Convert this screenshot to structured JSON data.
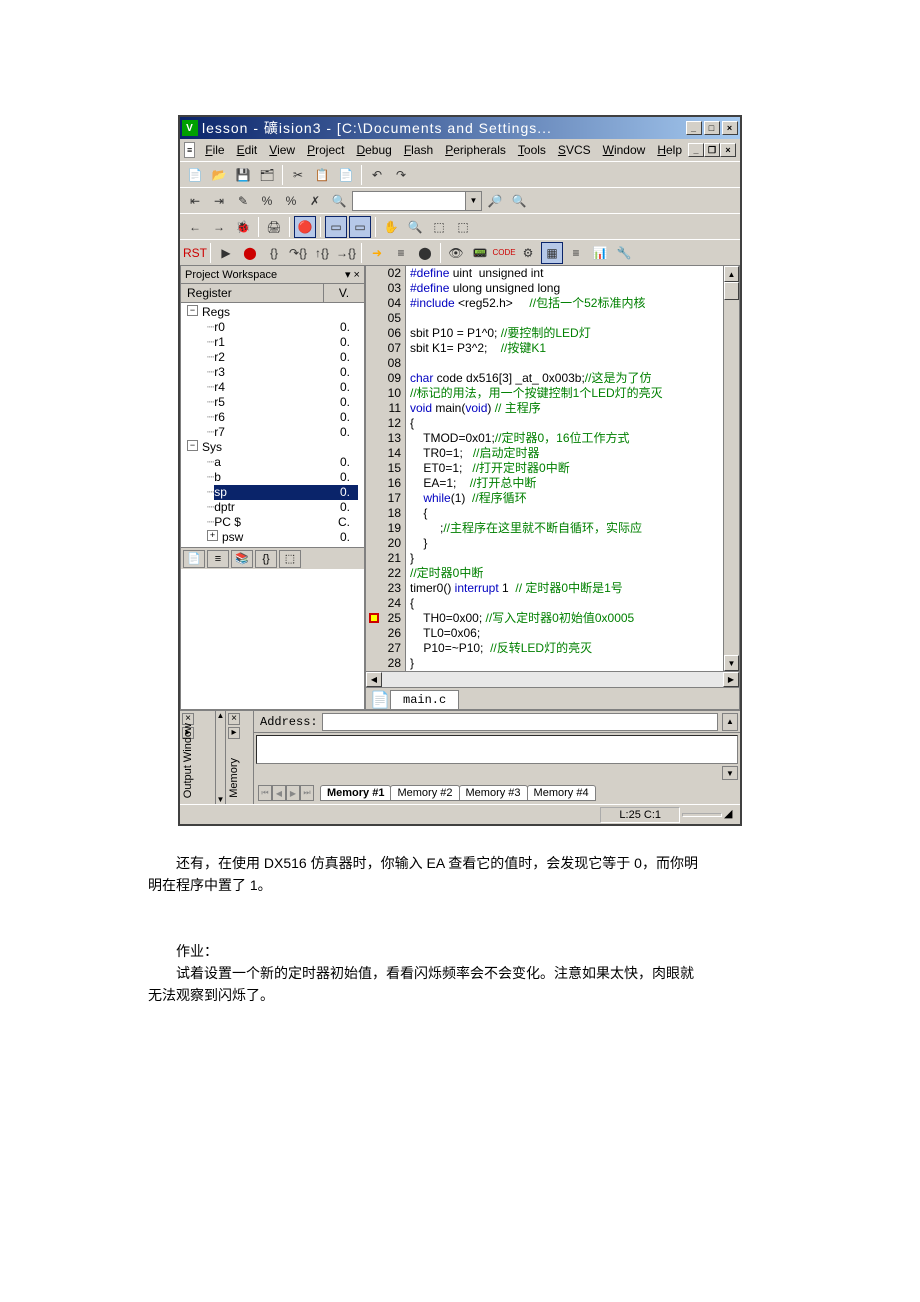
{
  "titlebar": {
    "icon_text": "V",
    "title": "lesson  - 礦ision3 - [C:\\Documents and Settings..."
  },
  "menus": [
    "File",
    "Edit",
    "View",
    "Project",
    "Debug",
    "Flash",
    "Peripherals",
    "Tools",
    "SVCS",
    "Window",
    "Help"
  ],
  "workspace": {
    "title": "Project Workspace",
    "reg_header": "Register",
    "val_header": "V.",
    "regs_root": "Regs",
    "sys_root": "Sys",
    "regs": [
      {
        "n": "r0",
        "v": "0."
      },
      {
        "n": "r1",
        "v": "0."
      },
      {
        "n": "r2",
        "v": "0."
      },
      {
        "n": "r3",
        "v": "0."
      },
      {
        "n": "r4",
        "v": "0."
      },
      {
        "n": "r5",
        "v": "0."
      },
      {
        "n": "r6",
        "v": "0."
      },
      {
        "n": "r7",
        "v": "0."
      }
    ],
    "sys": [
      {
        "n": "a",
        "v": "0."
      },
      {
        "n": "b",
        "v": "0."
      },
      {
        "n": "sp",
        "v": "0.",
        "sel": true
      },
      {
        "n": "dptr",
        "v": "0."
      },
      {
        "n": "PC  $",
        "v": "C."
      },
      {
        "n": "psw",
        "v": "0.",
        "expand": "+"
      }
    ]
  },
  "code_lines": [
    {
      "n": "02",
      "t": [
        {
          "c": "kw",
          "s": "#define"
        },
        {
          "c": "tx",
          "s": " uint  unsigned int"
        }
      ]
    },
    {
      "n": "03",
      "t": [
        {
          "c": "kw",
          "s": "#define"
        },
        {
          "c": "tx",
          "s": " ulong unsigned long"
        }
      ]
    },
    {
      "n": "04",
      "t": [
        {
          "c": "kw",
          "s": "#include"
        },
        {
          "c": "tx",
          "s": " <reg52.h>     "
        },
        {
          "c": "cm",
          "s": "//包括一个52标准内核"
        }
      ]
    },
    {
      "n": "05",
      "t": []
    },
    {
      "n": "06",
      "t": [
        {
          "c": "tx",
          "s": "sbit P10 = P1^0; "
        },
        {
          "c": "cm",
          "s": "//要控制的LED灯"
        }
      ]
    },
    {
      "n": "07",
      "t": [
        {
          "c": "tx",
          "s": "sbit K1= P3^2;    "
        },
        {
          "c": "cm",
          "s": "//按键K1"
        }
      ]
    },
    {
      "n": "08",
      "t": []
    },
    {
      "n": "09",
      "t": [
        {
          "c": "kw",
          "s": "char"
        },
        {
          "c": "tx",
          "s": " code dx516[3] _at_ 0x003b;"
        },
        {
          "c": "cm",
          "s": "//这是为了仿"
        }
      ]
    },
    {
      "n": "10",
      "t": [
        {
          "c": "cm",
          "s": "//标记的用法，用一个按键控制1个LED灯的亮灭"
        }
      ]
    },
    {
      "n": "11",
      "t": [
        {
          "c": "kw",
          "s": "void"
        },
        {
          "c": "tx",
          "s": " main("
        },
        {
          "c": "kw",
          "s": "void"
        },
        {
          "c": "tx",
          "s": ") "
        },
        {
          "c": "cm",
          "s": "// 主程序"
        }
      ]
    },
    {
      "n": "12",
      "t": [
        {
          "c": "tx",
          "s": "{"
        }
      ]
    },
    {
      "n": "13",
      "t": [
        {
          "c": "tx",
          "s": "    TMOD=0x01;"
        },
        {
          "c": "cm",
          "s": "//定时器0，16位工作方式"
        }
      ]
    },
    {
      "n": "14",
      "t": [
        {
          "c": "tx",
          "s": "    TR0=1;   "
        },
        {
          "c": "cm",
          "s": "//启动定时器"
        }
      ]
    },
    {
      "n": "15",
      "t": [
        {
          "c": "tx",
          "s": "    ET0=1;   "
        },
        {
          "c": "cm",
          "s": "//打开定时器0中断"
        }
      ]
    },
    {
      "n": "16",
      "t": [
        {
          "c": "tx",
          "s": "    EA=1;    "
        },
        {
          "c": "cm",
          "s": "//打开总中断"
        }
      ]
    },
    {
      "n": "17",
      "t": [
        {
          "c": "tx",
          "s": "    "
        },
        {
          "c": "kw",
          "s": "while"
        },
        {
          "c": "tx",
          "s": "(1)  "
        },
        {
          "c": "cm",
          "s": "//程序循环"
        }
      ]
    },
    {
      "n": "18",
      "t": [
        {
          "c": "tx",
          "s": "    {"
        }
      ]
    },
    {
      "n": "19",
      "t": [
        {
          "c": "tx",
          "s": "         ;"
        },
        {
          "c": "cm",
          "s": "//主程序在这里就不断自循环，实际应"
        }
      ]
    },
    {
      "n": "20",
      "t": [
        {
          "c": "tx",
          "s": "    }"
        }
      ]
    },
    {
      "n": "21",
      "t": [
        {
          "c": "tx",
          "s": "}"
        }
      ]
    },
    {
      "n": "22",
      "t": [
        {
          "c": "cm",
          "s": "//定时器0中断"
        }
      ]
    },
    {
      "n": "23",
      "t": [
        {
          "c": "tx",
          "s": "timer0() "
        },
        {
          "c": "kw",
          "s": "interrupt"
        },
        {
          "c": "tx",
          "s": " 1  "
        },
        {
          "c": "cm",
          "s": "// 定时器0中断是1号"
        }
      ]
    },
    {
      "n": "24",
      "t": [
        {
          "c": "tx",
          "s": "{"
        }
      ]
    },
    {
      "n": "25",
      "bp": true,
      "t": [
        {
          "c": "tx",
          "s": "    TH0=0x00; "
        },
        {
          "c": "cm",
          "s": "//写入定时器0初始值0x0005"
        }
      ]
    },
    {
      "n": "26",
      "t": [
        {
          "c": "tx",
          "s": "    TL0=0x06;"
        }
      ]
    },
    {
      "n": "27",
      "t": [
        {
          "c": "tx",
          "s": "    P10=~P10;  "
        },
        {
          "c": "cm",
          "s": "//反转LED灯的亮灭"
        }
      ]
    },
    {
      "n": "28",
      "t": [
        {
          "c": "tx",
          "s": "}"
        }
      ]
    }
  ],
  "editor_tab": "main.c",
  "memory": {
    "addr_label": "Address:",
    "tabs": [
      "Memory #1",
      "Memory #2",
      "Memory #3",
      "Memory #4"
    ]
  },
  "output_label": "Output Window",
  "mem_vlabel": "Memory",
  "status": {
    "pos": "L:25 C:1"
  },
  "body_text": {
    "p1": "还有，在使用 DX516 仿真器时，你输入 EA 查看它的值时，会发现它等于 0，而你明",
    "p1b": "明在程序中置了 1。",
    "p2": "作业：",
    "p3": "试着设置一个新的定时器初始值，看看闪烁频率会不会变化。注意如果太快，肉眼就",
    "p3b": "无法观察到闪烁了。"
  }
}
